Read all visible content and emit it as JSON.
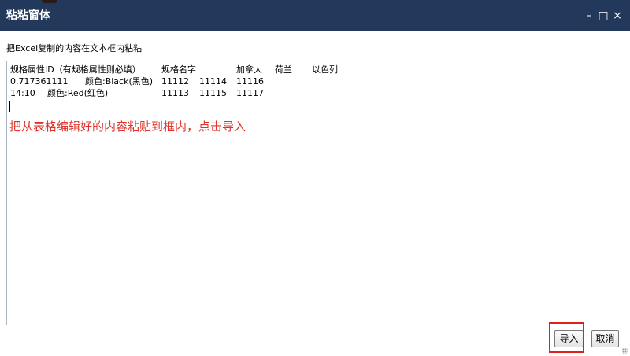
{
  "window": {
    "title": "粘粘窗体",
    "controls": {
      "minimize": "–",
      "maximize": "□",
      "close": "×"
    }
  },
  "instruction": "把Excel复制的内容在文本框内粘粘",
  "paste_area": {
    "rows": [
      [
        "规格属性ID（有规格属性则必填）",
        "规格名字",
        "加拿大",
        "荷兰",
        "以色列"
      ],
      [
        "0.717361111",
        "颜色:Black(黑色)",
        "11112",
        "11114",
        "11116"
      ],
      [
        "14:10",
        "颜色:Red(红色)",
        "11113",
        "11115",
        "11117"
      ]
    ],
    "annotation": "把从表格编辑好的内容粘贴到框内，点击导入"
  },
  "buttons": {
    "import_label": "导入",
    "cancel_label": "取消"
  },
  "colors": {
    "titlebar": "#23395b",
    "annotation": "#e0332b",
    "highlight": "#e0201b"
  }
}
